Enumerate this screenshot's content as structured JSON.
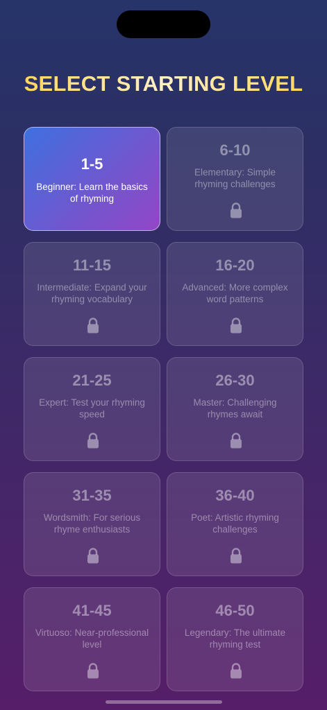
{
  "title": "SELECT STARTING LEVEL",
  "colors": {
    "title_gold": "#ffd34a",
    "active_gradient_start": "#3f70e0",
    "active_gradient_end": "#9346c6"
  },
  "levels": [
    {
      "range": "1-5",
      "desc": "Beginner: Learn the basics of rhyming",
      "locked": false,
      "selected": true
    },
    {
      "range": "6-10",
      "desc": "Elementary: Simple rhyming challenges",
      "locked": true,
      "selected": false
    },
    {
      "range": "11-15",
      "desc": "Intermediate: Expand your rhyming vocabulary",
      "locked": true,
      "selected": false
    },
    {
      "range": "16-20",
      "desc": "Advanced: More complex word patterns",
      "locked": true,
      "selected": false
    },
    {
      "range": "21-25",
      "desc": "Expert: Test your rhyming speed",
      "locked": true,
      "selected": false
    },
    {
      "range": "26-30",
      "desc": "Master: Challenging rhymes await",
      "locked": true,
      "selected": false
    },
    {
      "range": "31-35",
      "desc": "Wordsmith: For serious rhyme enthusiasts",
      "locked": true,
      "selected": false
    },
    {
      "range": "36-40",
      "desc": "Poet: Artistic rhyming challenges",
      "locked": true,
      "selected": false
    },
    {
      "range": "41-45",
      "desc": "Virtuoso: Near-professional level",
      "locked": true,
      "selected": false
    },
    {
      "range": "46-50",
      "desc": "Legendary: The ultimate rhyming test",
      "locked": true,
      "selected": false
    }
  ],
  "lock_icon": "lock-icon"
}
